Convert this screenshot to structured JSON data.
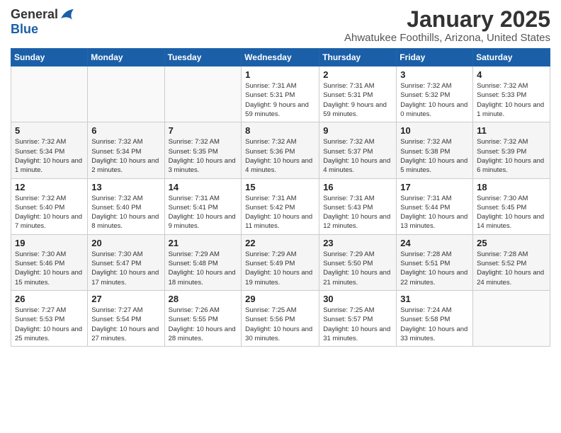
{
  "logo": {
    "general": "General",
    "blue": "Blue"
  },
  "header": {
    "month": "January 2025",
    "location": "Ahwatukee Foothills, Arizona, United States"
  },
  "days_of_week": [
    "Sunday",
    "Monday",
    "Tuesday",
    "Wednesday",
    "Thursday",
    "Friday",
    "Saturday"
  ],
  "weeks": [
    [
      {
        "day": "",
        "info": ""
      },
      {
        "day": "",
        "info": ""
      },
      {
        "day": "",
        "info": ""
      },
      {
        "day": "1",
        "info": "Sunrise: 7:31 AM\nSunset: 5:31 PM\nDaylight: 9 hours and 59 minutes."
      },
      {
        "day": "2",
        "info": "Sunrise: 7:31 AM\nSunset: 5:31 PM\nDaylight: 9 hours and 59 minutes."
      },
      {
        "day": "3",
        "info": "Sunrise: 7:32 AM\nSunset: 5:32 PM\nDaylight: 10 hours and 0 minutes."
      },
      {
        "day": "4",
        "info": "Sunrise: 7:32 AM\nSunset: 5:33 PM\nDaylight: 10 hours and 1 minute."
      }
    ],
    [
      {
        "day": "5",
        "info": "Sunrise: 7:32 AM\nSunset: 5:34 PM\nDaylight: 10 hours and 1 minute."
      },
      {
        "day": "6",
        "info": "Sunrise: 7:32 AM\nSunset: 5:34 PM\nDaylight: 10 hours and 2 minutes."
      },
      {
        "day": "7",
        "info": "Sunrise: 7:32 AM\nSunset: 5:35 PM\nDaylight: 10 hours and 3 minutes."
      },
      {
        "day": "8",
        "info": "Sunrise: 7:32 AM\nSunset: 5:36 PM\nDaylight: 10 hours and 4 minutes."
      },
      {
        "day": "9",
        "info": "Sunrise: 7:32 AM\nSunset: 5:37 PM\nDaylight: 10 hours and 4 minutes."
      },
      {
        "day": "10",
        "info": "Sunrise: 7:32 AM\nSunset: 5:38 PM\nDaylight: 10 hours and 5 minutes."
      },
      {
        "day": "11",
        "info": "Sunrise: 7:32 AM\nSunset: 5:39 PM\nDaylight: 10 hours and 6 minutes."
      }
    ],
    [
      {
        "day": "12",
        "info": "Sunrise: 7:32 AM\nSunset: 5:40 PM\nDaylight: 10 hours and 7 minutes."
      },
      {
        "day": "13",
        "info": "Sunrise: 7:32 AM\nSunset: 5:40 PM\nDaylight: 10 hours and 8 minutes."
      },
      {
        "day": "14",
        "info": "Sunrise: 7:31 AM\nSunset: 5:41 PM\nDaylight: 10 hours and 9 minutes."
      },
      {
        "day": "15",
        "info": "Sunrise: 7:31 AM\nSunset: 5:42 PM\nDaylight: 10 hours and 11 minutes."
      },
      {
        "day": "16",
        "info": "Sunrise: 7:31 AM\nSunset: 5:43 PM\nDaylight: 10 hours and 12 minutes."
      },
      {
        "day": "17",
        "info": "Sunrise: 7:31 AM\nSunset: 5:44 PM\nDaylight: 10 hours and 13 minutes."
      },
      {
        "day": "18",
        "info": "Sunrise: 7:30 AM\nSunset: 5:45 PM\nDaylight: 10 hours and 14 minutes."
      }
    ],
    [
      {
        "day": "19",
        "info": "Sunrise: 7:30 AM\nSunset: 5:46 PM\nDaylight: 10 hours and 15 minutes."
      },
      {
        "day": "20",
        "info": "Sunrise: 7:30 AM\nSunset: 5:47 PM\nDaylight: 10 hours and 17 minutes."
      },
      {
        "day": "21",
        "info": "Sunrise: 7:29 AM\nSunset: 5:48 PM\nDaylight: 10 hours and 18 minutes."
      },
      {
        "day": "22",
        "info": "Sunrise: 7:29 AM\nSunset: 5:49 PM\nDaylight: 10 hours and 19 minutes."
      },
      {
        "day": "23",
        "info": "Sunrise: 7:29 AM\nSunset: 5:50 PM\nDaylight: 10 hours and 21 minutes."
      },
      {
        "day": "24",
        "info": "Sunrise: 7:28 AM\nSunset: 5:51 PM\nDaylight: 10 hours and 22 minutes."
      },
      {
        "day": "25",
        "info": "Sunrise: 7:28 AM\nSunset: 5:52 PM\nDaylight: 10 hours and 24 minutes."
      }
    ],
    [
      {
        "day": "26",
        "info": "Sunrise: 7:27 AM\nSunset: 5:53 PM\nDaylight: 10 hours and 25 minutes."
      },
      {
        "day": "27",
        "info": "Sunrise: 7:27 AM\nSunset: 5:54 PM\nDaylight: 10 hours and 27 minutes."
      },
      {
        "day": "28",
        "info": "Sunrise: 7:26 AM\nSunset: 5:55 PM\nDaylight: 10 hours and 28 minutes."
      },
      {
        "day": "29",
        "info": "Sunrise: 7:25 AM\nSunset: 5:56 PM\nDaylight: 10 hours and 30 minutes."
      },
      {
        "day": "30",
        "info": "Sunrise: 7:25 AM\nSunset: 5:57 PM\nDaylight: 10 hours and 31 minutes."
      },
      {
        "day": "31",
        "info": "Sunrise: 7:24 AM\nSunset: 5:58 PM\nDaylight: 10 hours and 33 minutes."
      },
      {
        "day": "",
        "info": ""
      }
    ]
  ]
}
